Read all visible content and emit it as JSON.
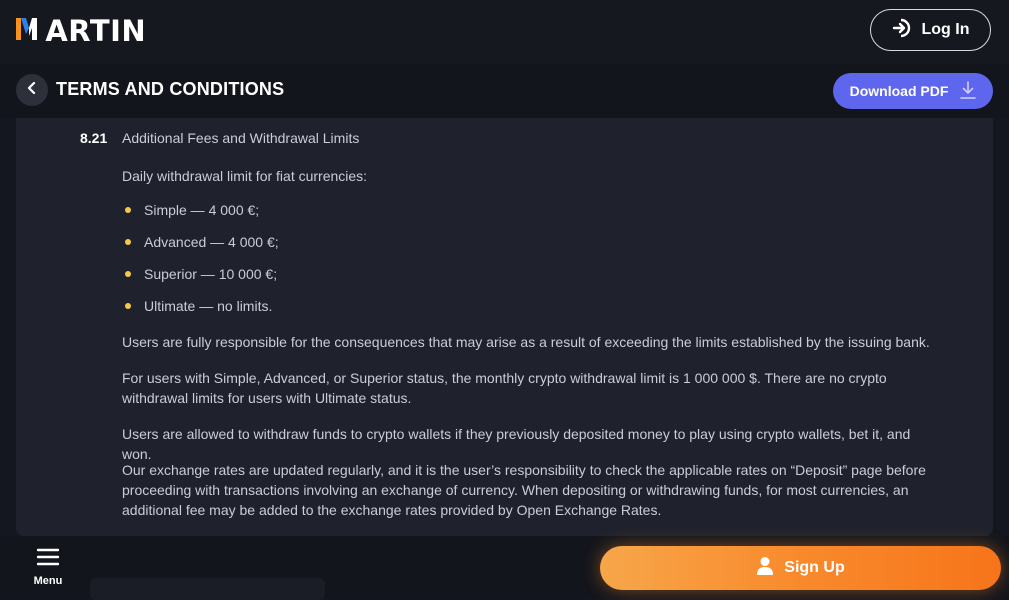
{
  "header": {
    "logo_rest": "ARTIN",
    "login_label": "Log In"
  },
  "titlebar": {
    "title": "TERMS AND CONDITIONS",
    "download_label": "Download PDF"
  },
  "section": {
    "number": "8.21",
    "title": "Additional Fees and Withdrawal Limits",
    "intro": "Daily withdrawal limit for fiat currencies:",
    "limits": [
      "Simple — 4 000 €;",
      "Advanced — 4 000 €;",
      "Superior — 10 000 €;",
      "Ultimate — no limits."
    ],
    "paragraphs": [
      "Users are fully responsible for the consequences that may arise as a result of exceeding the limits established by the issuing bank.",
      "For users with Simple, Advanced, or Superior status, the monthly crypto withdrawal limit is 1 000 000 $. There are no crypto withdrawal limits for users with Ultimate status.",
      "Users are allowed to withdraw funds to crypto wallets if they previously deposited money to play using crypto wallets, bet it, and won.",
      "Our exchange rates are updated regularly, and it is the user’s responsibility to check the applicable rates on “Deposit” page before proceeding with transactions involving an exchange of currency. When depositing or withdrawing funds, for most currencies, an additional fee may be added to the exchange rates provided by Open Exchange Rates."
    ]
  },
  "bottom": {
    "menu_label": "Menu",
    "signup_label": "Sign Up"
  },
  "colors": {
    "accent_purple": "#5f66ee",
    "accent_orange": "#f88a2c",
    "bullet_yellow": "#f2c94c",
    "logo_orange": "#f7931e",
    "logo_blue": "#2f80ed"
  },
  "icons": [
    "logo-m-icon",
    "login-icon",
    "chevron-left-icon",
    "download-icon",
    "menu-icon",
    "user-icon"
  ]
}
